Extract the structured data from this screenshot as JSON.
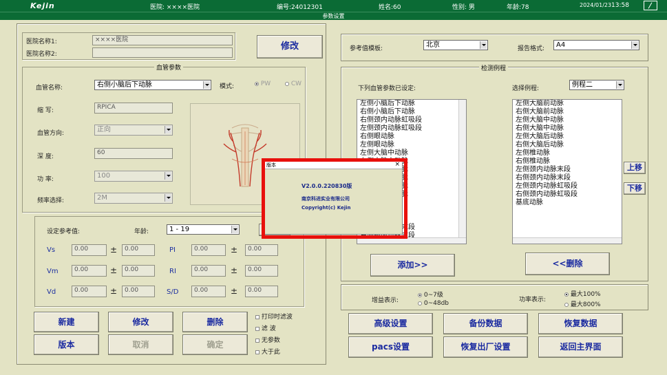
{
  "header": {
    "brand": "Kejin",
    "hospital": "医院: ××××医院",
    "number": "编号:24012301",
    "name": "姓名:60",
    "gender": "性别: 男",
    "age": "年龄:78",
    "date": "2024/01/23",
    "time": "13:58",
    "subtitle": "参数设置"
  },
  "hospital": {
    "label1": "医院名称1:",
    "label2": "医院名称2:",
    "value1": "××××医院",
    "value2": "",
    "modify_btn": "修改"
  },
  "vessel": {
    "legend": "血管参数",
    "name_label": "血管名称:",
    "name_value": "右侧小脑后下动脉",
    "mode_label": "模式:",
    "mode_pw": "PW",
    "mode_cw": "CW",
    "abbr_label": "缩  写:",
    "abbr_value": "RPICA",
    "dir_label": "血管方向:",
    "dir_value": "正向",
    "depth_label": "深  度:",
    "depth_value": "60",
    "power_label": "功  率:",
    "power_value": "100",
    "freq_label": "频率选择:",
    "freq_value": "2M"
  },
  "ref": {
    "set_label": "设定参考值:",
    "age_label": "年龄:",
    "age_value": "1 - 19",
    "save_btn": "保存",
    "pm": "±",
    "rows": [
      {
        "l1": "Vs",
        "a": "0.00",
        "b": "0.00",
        "l2": "PI",
        "c": "0.00",
        "d": "0.00"
      },
      {
        "l1": "Vm",
        "a": "0.00",
        "b": "0.00",
        "l2": "RI",
        "c": "0.00",
        "d": "0.00"
      },
      {
        "l1": "Vd",
        "a": "0.00",
        "b": "0.00",
        "l2": "S/D",
        "c": "0.00",
        "d": "0.00"
      }
    ]
  },
  "left_buttons": {
    "new": "新建",
    "modify": "修改",
    "delete": "删除",
    "version": "版本",
    "cancel": "取消",
    "confirm": "确定"
  },
  "checks": {
    "c1": "打印时滤波",
    "c2": "滤  波",
    "c3": "无参数",
    "c4": "大于此"
  },
  "template": {
    "label": "参考值模板:",
    "value": "北京",
    "format_label": "报告格式:",
    "format_value": "A4"
  },
  "procedure": {
    "legend": "检测例程",
    "set_label": "下列血管参数已设定:",
    "select_label": "选择例程:",
    "select_value": "例程二",
    "left_list": [
      "左侧小脑后下动脉",
      "右侧小脑后下动脉",
      "右侧颈内动脉虹吸段",
      "左侧颈内动脉虹吸段",
      "右侧眼动脉",
      "左侧眼动脉",
      "左侧大脑中动脉",
      "右侧大脑中动脉",
      "左侧大脑前动脉",
      "右侧大脑前动脉",
      "左侧大脑后动脉",
      "右侧大脑后动脉",
      "左侧椎动脉",
      "右侧椎动脉",
      "基底动脉",
      "右侧颈内动脉末段",
      "右侧颈内动脉末段",
      "右侧颈内动脉颅外段"
    ],
    "right_list": [
      "左侧大脑前动脉",
      "右侧大脑前动脉",
      "左侧大脑中动脉",
      "右侧大脑中动脉",
      "左侧大脑后动脉",
      "右侧大脑后动脉",
      "左侧椎动脉",
      "右侧椎动脉",
      "左侧颈内动脉末段",
      "右侧颈内动脉末段",
      "左侧颈内动脉虹吸段",
      "右侧颈内动脉虹吸段",
      "基底动脉"
    ],
    "up_btn": "上移",
    "down_btn": "下移",
    "add_btn": "添加>>",
    "del_btn": "<<删除"
  },
  "gain": {
    "label": "增益表示:",
    "opt1": "0~7级",
    "opt2": "0~48db",
    "power_label": "功率表示:",
    "popt1": "最大100%",
    "popt2": "最大800%"
  },
  "right_buttons": {
    "advanced": "高级设置",
    "backup": "备份数据",
    "restore": "恢复数据",
    "pacs": "pacs设置",
    "factory": "恢复出厂设置",
    "back": "返回主界面"
  },
  "dialog": {
    "title": "版本",
    "version": "V2.0.0.220830版",
    "company": "南京科进实业有限公司",
    "copyright": "Copyright(c)  Kejin"
  },
  "colors": {
    "background": "#e3e3c4",
    "header": "#0b6b35",
    "button_text": "#1a2aa0",
    "highlight": "#e8100c"
  }
}
